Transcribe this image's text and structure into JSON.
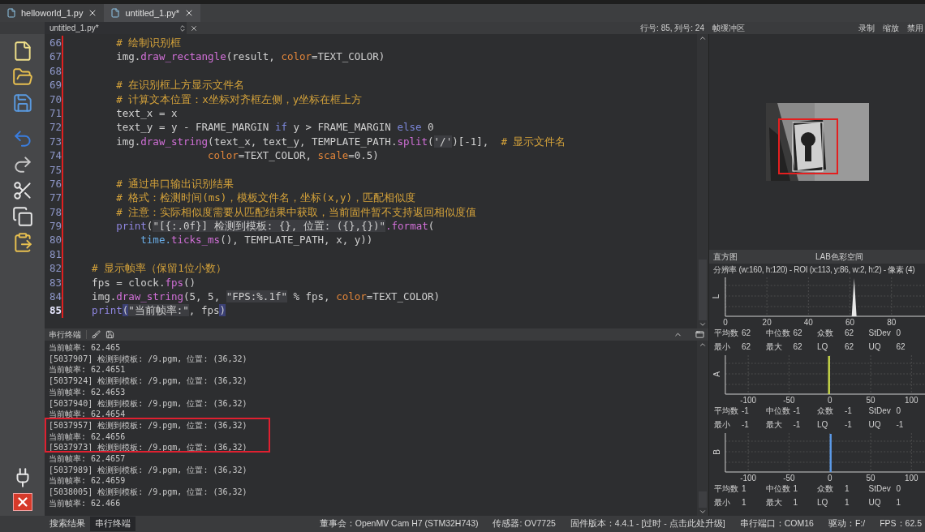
{
  "file_tabs": [
    {
      "label": "helloworld_1.py",
      "selected": false
    },
    {
      "label": "untitled_1.py*",
      "selected": true
    }
  ],
  "editor": {
    "file": "untitled_1.py*",
    "cursor": "行号: 85, 列号: 24",
    "lines": [
      {
        "number": "66",
        "current": false,
        "modified": true,
        "tokens": [
          {
            "kind": "comment",
            "text": "        # 绘制识别框"
          }
        ]
      },
      {
        "number": "67",
        "current": false,
        "modified": true,
        "tokens": [
          {
            "kind": "plain",
            "text": "        img."
          },
          {
            "kind": "function",
            "text": "draw_rectangle"
          },
          {
            "kind": "plain",
            "text": "(result, "
          },
          {
            "kind": "argument",
            "text": "color"
          },
          {
            "kind": "plain",
            "text": "=TEXT_COLOR)"
          }
        ]
      },
      {
        "number": "68",
        "current": false,
        "modified": true
      },
      {
        "number": "69",
        "current": false,
        "modified": true,
        "tokens": [
          {
            "kind": "comment",
            "text": "        # 在识别框上方显示文件名"
          }
        ]
      },
      {
        "number": "70",
        "current": false,
        "modified": true,
        "tokens": [
          {
            "kind": "comment",
            "text": "        # 计算文本位置：x坐标对齐框左侧，y坐标在框上方"
          }
        ]
      },
      {
        "number": "71",
        "current": false,
        "modified": true,
        "tokens": [
          {
            "kind": "plain",
            "text": "        text_x = x"
          }
        ]
      },
      {
        "number": "72",
        "current": false,
        "modified": true,
        "tokens": [
          {
            "kind": "plain",
            "text": "        text_y = y - FRAME_MARGIN "
          },
          {
            "kind": "keyword",
            "text": "if"
          },
          {
            "kind": "plain",
            "text": " y > FRAME_MARGIN "
          },
          {
            "kind": "keyword",
            "text": "else"
          },
          {
            "kind": "plain",
            "text": " 0"
          }
        ]
      },
      {
        "number": "73",
        "current": false,
        "modified": true,
        "tokens": [
          {
            "kind": "plain",
            "text": "        img."
          },
          {
            "kind": "function",
            "text": "draw_string"
          },
          {
            "kind": "plain",
            "text": "(text_x, text_y, TEMPLATE_PATH."
          },
          {
            "kind": "function",
            "text": "split"
          },
          {
            "kind": "plain",
            "text": "("
          },
          {
            "kind": "string",
            "text": "'/'"
          },
          {
            "kind": "plain",
            "text": ")[-1],  "
          },
          {
            "kind": "comment",
            "text": "# 显示文件名"
          }
        ]
      },
      {
        "number": "74",
        "current": false,
        "modified": true,
        "tokens": [
          {
            "kind": "argument",
            "text": "                       color"
          },
          {
            "kind": "plain",
            "text": "=TEXT_COLOR, "
          },
          {
            "kind": "argument",
            "text": "scale"
          },
          {
            "kind": "plain",
            "text": "=0.5)"
          }
        ]
      },
      {
        "number": "75",
        "current": false,
        "modified": true
      },
      {
        "number": "76",
        "current": false,
        "modified": true,
        "tokens": [
          {
            "kind": "comment",
            "text": "        # 通过串口输出识别结果"
          }
        ]
      },
      {
        "number": "77",
        "current": false,
        "modified": true,
        "tokens": [
          {
            "kind": "comment",
            "text": "        # 格式：检测时间(ms)，模板文件名，坐标(x,y)，匹配相似度"
          }
        ]
      },
      {
        "number": "78",
        "current": false,
        "modified": true,
        "tokens": [
          {
            "kind": "comment",
            "text": "        # 注意：实际相似度需要从匹配结果中获取，当前固件暂不支持返回相似度值"
          }
        ]
      },
      {
        "number": "79",
        "current": false,
        "modified": true,
        "tokens": [
          {
            "kind": "builtin",
            "text": "        print"
          },
          {
            "kind": "plain",
            "text": "("
          },
          {
            "kind": "string",
            "text": "\"[{:.0f}] 检测到模板: {}, 位置: ({},{})\""
          },
          {
            "kind": "function",
            "text": ".format"
          },
          {
            "kind": "plain",
            "text": "("
          }
        ]
      },
      {
        "number": "80",
        "current": false,
        "modified": true,
        "tokens": [
          {
            "kind": "module",
            "text": "            time."
          },
          {
            "kind": "function",
            "text": "ticks_ms"
          },
          {
            "kind": "plain",
            "text": "(), TEMPLATE_PATH, x, y))"
          }
        ]
      },
      {
        "number": "81",
        "current": false,
        "modified": true
      },
      {
        "number": "82",
        "current": false,
        "modified": true,
        "tokens": [
          {
            "kind": "comment",
            "text": "    # 显示帧率（保留1位小数）"
          }
        ]
      },
      {
        "number": "83",
        "current": false,
        "modified": true,
        "tokens": [
          {
            "kind": "plain",
            "text": "    fps = clock."
          },
          {
            "kind": "function",
            "text": "fps"
          },
          {
            "kind": "plain",
            "text": "()"
          }
        ]
      },
      {
        "number": "84",
        "current": false,
        "modified": true,
        "tokens": [
          {
            "kind": "plain",
            "text": "    img."
          },
          {
            "kind": "function",
            "text": "draw_string"
          },
          {
            "kind": "plain",
            "text": "(5, 5, "
          },
          {
            "kind": "string",
            "text": "\"FPS:%.1f\""
          },
          {
            "kind": "plain",
            "text": " % fps, "
          },
          {
            "kind": "argument",
            "text": "color"
          },
          {
            "kind": "plain",
            "text": "=TEXT_COLOR)"
          }
        ]
      },
      {
        "number": "85",
        "current": true,
        "modified": true,
        "tokens": [
          {
            "kind": "builtin",
            "text": "    print"
          },
          {
            "kind": "match",
            "text": "("
          },
          {
            "kind": "string",
            "text": "\"当前帧率:\""
          },
          {
            "kind": "plain",
            "text": ", fps"
          },
          {
            "kind": "match",
            "text": ")"
          }
        ]
      }
    ]
  },
  "frame_buffer": {
    "title": "帧缓冲区",
    "buttons": [
      "录制",
      "缩放",
      "禁用"
    ],
    "image": {
      "kind": "picture"
    }
  },
  "histogram": {
    "title": "直方图",
    "color_space": "LAB色彩空间",
    "info": "分辨率 (w:160, h:120) - ROI (x:113, y:86, w:2, h:2) - 像素 (4)",
    "channels": [
      {
        "name": "L",
        "kind": "lightness",
        "color": "#e8e8e8",
        "ticks": [
          "0",
          "20",
          "40",
          "60",
          "80"
        ],
        "stats": [
          {
            "label": "平均数",
            "value": "62"
          },
          {
            "label": "中位数",
            "value": "62"
          },
          {
            "label": "众数",
            "value": "62"
          },
          {
            "label": "StDev",
            "value": "0"
          },
          {
            "label": "最小",
            "value": "62"
          },
          {
            "label": "最大",
            "value": "62"
          },
          {
            "label": "LQ",
            "value": "62"
          },
          {
            "label": "UQ",
            "value": "62"
          }
        ]
      },
      {
        "name": "A",
        "kind": "opponent",
        "color": "#c8d848",
        "ticks": [
          "-100",
          "-50",
          "0",
          "50",
          "100"
        ],
        "stats": [
          {
            "label": "平均数",
            "value": "-1"
          },
          {
            "label": "中位数",
            "value": "-1"
          },
          {
            "label": "众数",
            "value": "-1"
          },
          {
            "label": "StDev",
            "value": "0"
          },
          {
            "label": "最小",
            "value": "-1"
          },
          {
            "label": "最大",
            "value": "-1"
          },
          {
            "label": "LQ",
            "value": "-1"
          },
          {
            "label": "UQ",
            "value": "-1"
          }
        ]
      },
      {
        "name": "B",
        "kind": "opponent",
        "color": "#5c9ae8",
        "ticks": [
          "-100",
          "-50",
          "0",
          "50",
          "100"
        ],
        "stats": [
          {
            "label": "平均数",
            "value": "1"
          },
          {
            "label": "中位数",
            "value": "1"
          },
          {
            "label": "众数",
            "value": "1"
          },
          {
            "label": "StDev",
            "value": "0"
          },
          {
            "label": "最小",
            "value": "1"
          },
          {
            "label": "最大",
            "value": "1"
          },
          {
            "label": "LQ",
            "value": "1"
          },
          {
            "label": "UQ",
            "value": "1"
          }
        ]
      }
    ]
  },
  "terminal": {
    "title": "串行终端",
    "lines": [
      "当前帧率: 62.465",
      "[5037907] 检测到模板: /9.pgm, 位置: (36,32)",
      "当前帧率: 62.4651",
      "[5037924] 检测到模板: /9.pgm, 位置: (36,32)",
      "当前帧率: 62.4653",
      "[5037940] 检测到模板: /9.pgm, 位置: (36,32)",
      "当前帧率: 62.4654",
      "[5037957] 检测到模板: /9.pgm, 位置: (36,32)",
      "当前帧率: 62.4656",
      "[5037973] 检测到模板: /9.pgm, 位置: (36,32)",
      "当前帧率: 62.4657",
      "[5037989] 检测到模板: /9.pgm, 位置: (36,32)",
      "当前帧率: 62.4659",
      "[5038005] 检测到模板: /9.pgm, 位置: (36,32)",
      "当前帧率: 62.466"
    ]
  },
  "bottom_tabs": [
    {
      "label": "搜索结果",
      "selected": false
    },
    {
      "label": "串行终端",
      "selected": true
    }
  ],
  "status_bar": [
    "董事会：OpenMV Cam H7 (STM32H743)",
    "传感器: OV7725",
    "固件版本：4.4.1 - [过时 - 点击此处升级]",
    "串行端口：COM16",
    "驱动：F:/",
    "FPS：62.5"
  ]
}
